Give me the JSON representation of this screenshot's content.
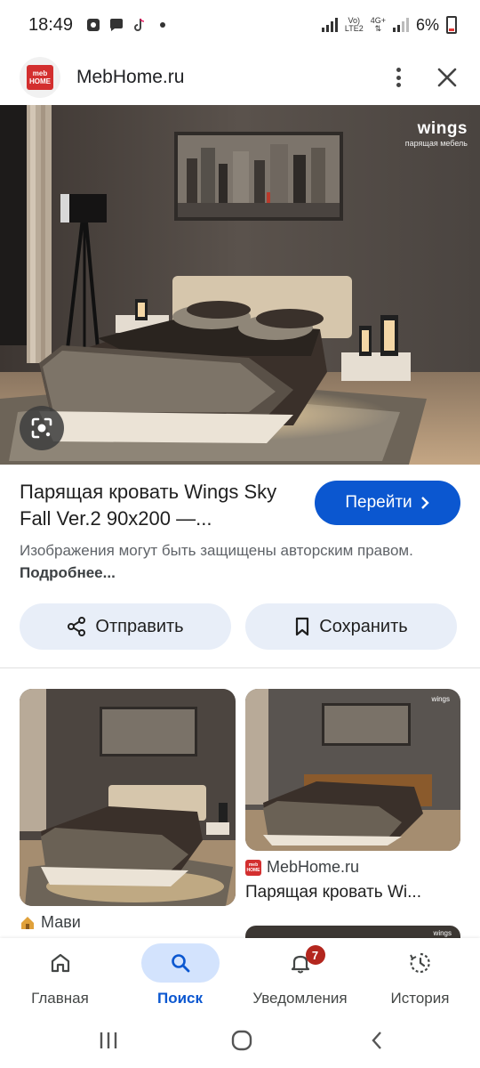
{
  "status_bar": {
    "time": "18:49",
    "network_label_top": "Vo)",
    "network_label_bottom": "LTE2",
    "network_type": "4G+",
    "battery": "6%"
  },
  "site": {
    "logo_text_top": "meb",
    "logo_text_bottom": "HOME",
    "name": "MebHome.ru"
  },
  "image": {
    "watermark_name": "wings",
    "watermark_tagline": "парящая мебель"
  },
  "result": {
    "title": "Парящая кровать Wings Sky Fall Ver.2 90x200 —...",
    "goto_label": "Перейти",
    "copyright_text": "Изображения могут быть защищены авторским правом.",
    "more_link": "Подробнее..."
  },
  "actions": {
    "share_label": "Отправить",
    "save_label": "Сохранить"
  },
  "related": [
    {
      "source": "Мави",
      "title": ""
    },
    {
      "source": "MebHome.ru",
      "title": "Парящая кровать Wi..."
    }
  ],
  "bottom_nav": {
    "items": [
      {
        "label": "Главная",
        "icon": "home-icon",
        "active": false
      },
      {
        "label": "Поиск",
        "icon": "search-icon",
        "active": true
      },
      {
        "label": "Уведомления",
        "icon": "bell-icon",
        "active": false,
        "badge": "7"
      },
      {
        "label": "История",
        "icon": "history-icon",
        "active": false
      }
    ]
  },
  "colors": {
    "accent": "#0b57d0",
    "action_bg": "#e8eef8",
    "active_nav_bg": "#d3e3fd",
    "badge": "#b3261e"
  }
}
